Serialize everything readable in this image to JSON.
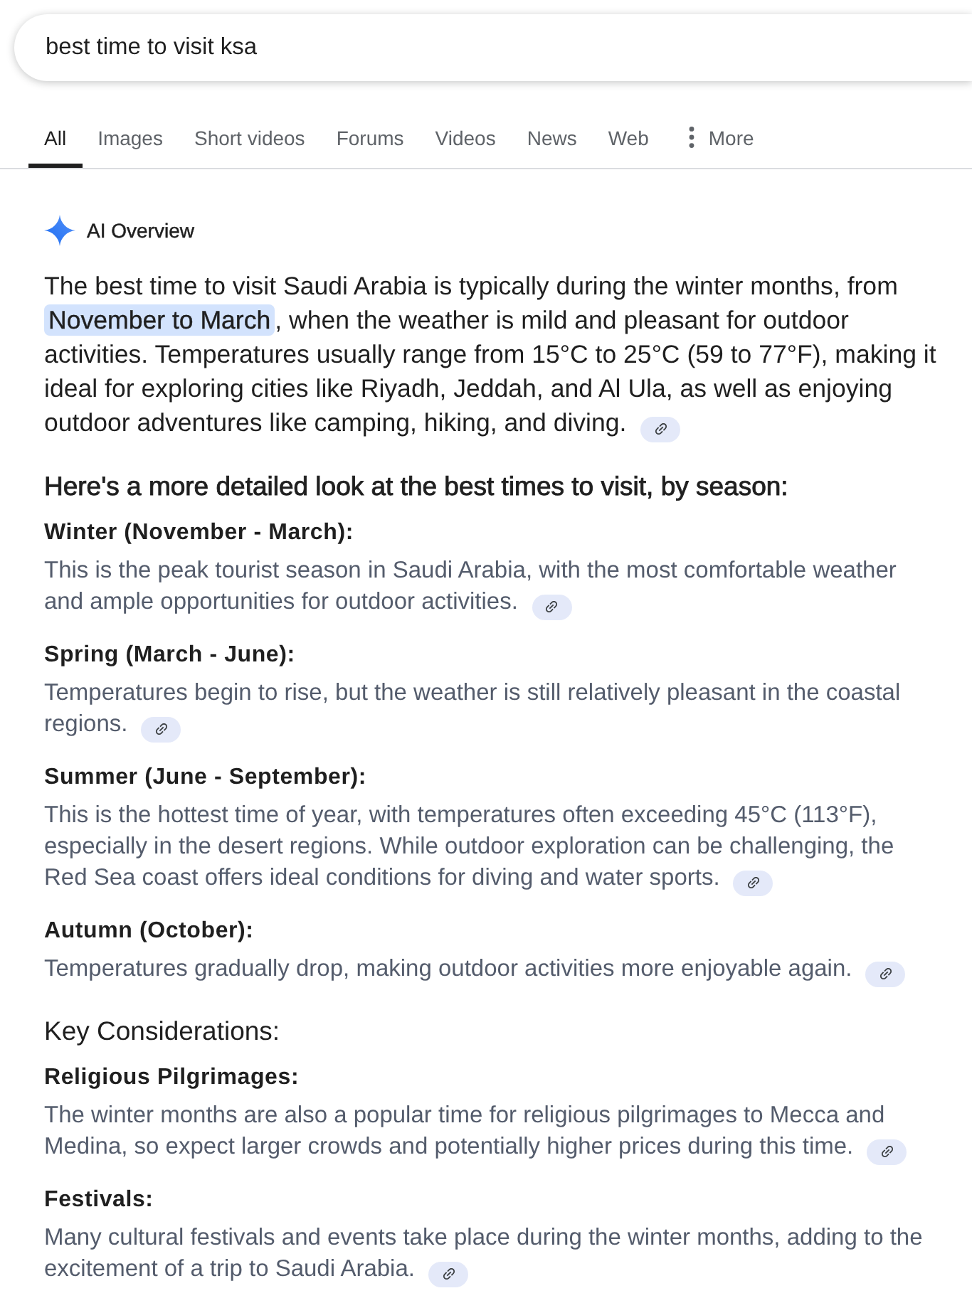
{
  "search": {
    "value": "best time to visit ksa"
  },
  "tabs": [
    {
      "label": "All",
      "selected": true,
      "kind": "tab"
    },
    {
      "label": "Images",
      "selected": false,
      "kind": "tab"
    },
    {
      "label": "Short videos",
      "selected": false,
      "kind": "tab"
    },
    {
      "label": "Forums",
      "selected": false,
      "kind": "tab"
    },
    {
      "label": "Videos",
      "selected": false,
      "kind": "tab"
    },
    {
      "label": "News",
      "selected": false,
      "kind": "tab"
    },
    {
      "label": "Web",
      "selected": false,
      "kind": "tab"
    },
    {
      "label": "More",
      "selected": false,
      "kind": "menu"
    }
  ],
  "ai_overview": {
    "title": "AI Overview",
    "summary": "The best time to visit Saudi Arabia is typically during the winter months, from **November to March**, when the weather is mild and pleasant for outdoor activities. Temperatures usually range from 15°C to 25°C (59 to 77°F), making it ideal for exploring cities like Riyadh, Jeddah, and Al Ula, as well as enjoying outdoor adventures like camping, hiking, and diving.",
    "sections": [
      {
        "heading": "Here's a more detailed look at the best times to visit, by season:",
        "heading_emphasized": true,
        "items": [
          {
            "title": "Winter (November - March):",
            "text": "This is the peak tourist season in Saudi Arabia, with the most comfortable weather and ample opportunities for outdoor activities."
          },
          {
            "title": "Spring (March - June):",
            "text": "Temperatures begin to rise, but the weather is still relatively pleasant in the coastal regions."
          },
          {
            "title": "Summer (June - September):",
            "text": "This is the hottest time of year, with temperatures often exceeding 45°C (113°F), especially in the desert regions. While outdoor exploration can be challenging, the Red Sea coast offers ideal conditions for diving and water sports."
          },
          {
            "title": "Autumn (October):",
            "text": "Temperatures gradually drop, making outdoor activities more enjoyable again."
          }
        ]
      },
      {
        "heading": "Key Considerations:",
        "heading_emphasized": false,
        "items": [
          {
            "title": "Religious Pilgrimages:",
            "text": "The winter months are also a popular time for religious pilgrimages to Mecca and Medina, so expect larger crowds and potentially higher prices during this time."
          },
          {
            "title": "Festivals:",
            "text": "Many cultural festivals and events take place during the winter months, adding to the excitement of a trip to Saudi Arabia."
          }
        ]
      }
    ]
  }
}
